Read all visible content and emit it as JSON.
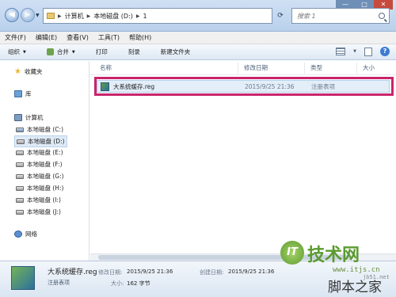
{
  "address": {
    "crumbs": [
      "计算机",
      "本地磁盘 (D:)",
      "1"
    ]
  },
  "search": {
    "placeholder": "搜索 1"
  },
  "menu": [
    "文件(F)",
    "编辑(E)",
    "查看(V)",
    "工具(T)",
    "帮助(H)"
  ],
  "toolbar": {
    "organize": "组织",
    "share": "合并",
    "print": "打印",
    "burn": "刻录",
    "new_folder": "新建文件夹"
  },
  "sidebar": {
    "favorites": "收藏夹",
    "libraries": "库",
    "computer": "计算机",
    "drives": [
      "本地磁盘 (C:)",
      "本地磁盘 (D:)",
      "本地磁盘 (E:)",
      "本地磁盘 (F:)",
      "本地磁盘 (G:)",
      "本地磁盘 (H:)",
      "本地磁盘 (I:)",
      "本地磁盘 (J:)"
    ],
    "network": "网络"
  },
  "columns": {
    "name": "名称",
    "modified": "修改日期",
    "type": "类型",
    "size": "大小"
  },
  "file": {
    "name": "大系统缓存.reg",
    "modified": "2015/9/25 21:36",
    "type": "注册表项"
  },
  "details": {
    "name": "大系统缓存.reg",
    "type": "注册表项",
    "modified_label": "修改日期:",
    "modified_value": "2015/9/25 21:36",
    "created_label": "创建日期:",
    "created_value": "2015/9/25 21:36",
    "size_label": "大小:",
    "size_value": "162 字节"
  },
  "watermark": {
    "badge": "IT",
    "brand": "技术网",
    "url": "www.itjs.cn",
    "url2": "jb51.net",
    "sub": "脚本之家"
  }
}
